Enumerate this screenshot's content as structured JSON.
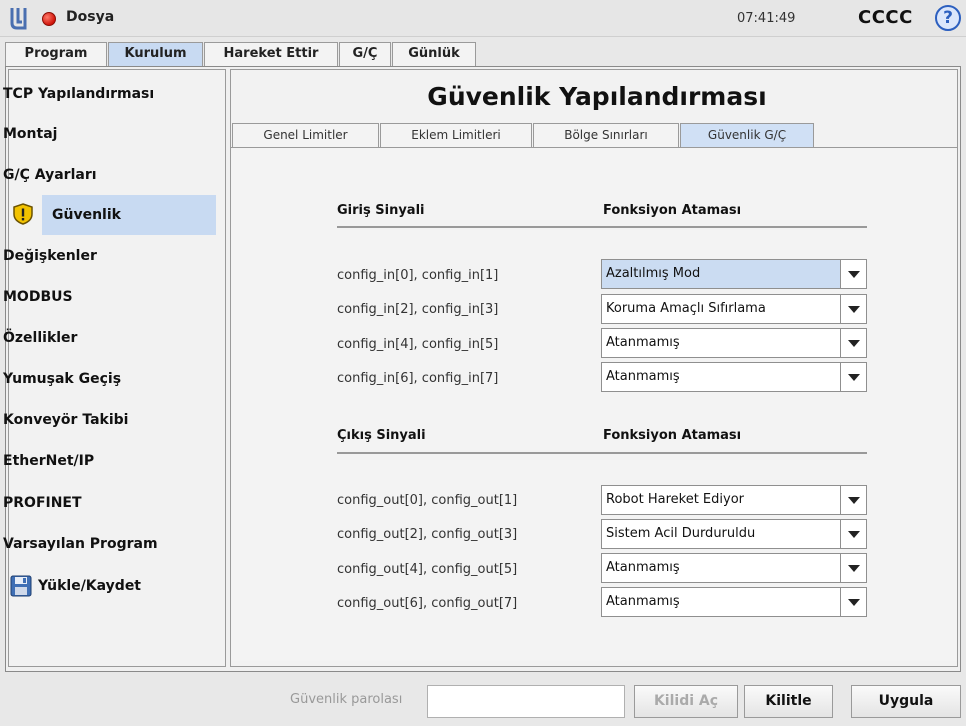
{
  "titlebar": {
    "app_name": "Dosya",
    "time": "07:41:49",
    "robot_name": "CCCC",
    "help": "?"
  },
  "top_tabs": [
    "Program",
    "Kurulum",
    "Hareket Ettir",
    "G/Ç",
    "Günlük"
  ],
  "active_top_tab": "Kurulum",
  "sidebar": {
    "items": [
      "TCP Yapılandırması",
      "Montaj",
      "G/Ç Ayarları",
      "Güvenlik",
      "Değişkenler",
      "MODBUS",
      "Özellikler",
      "Yumuşak Geçiş",
      "Konveyör Takibi",
      "EtherNet/IP",
      "PROFINET",
      "Varsayılan Program",
      "Yükle/Kaydet"
    ],
    "active": "Güvenlik"
  },
  "page": {
    "title": "Güvenlik Yapılandırması",
    "sub_tabs": [
      "Genel Limitler",
      "Eklem Limitleri",
      "Bölge Sınırları",
      "Güvenlik G/Ç"
    ],
    "active_sub_tab": "Güvenlik G/Ç"
  },
  "input_section": {
    "signal_header": "Giriş Sinyali",
    "function_header": "Fonksiyon Ataması",
    "rows": [
      {
        "signal": "config_in[0], config_in[1]",
        "function": "Azaltılmış Mod"
      },
      {
        "signal": "config_in[2], config_in[3]",
        "function": "Koruma Amaçlı Sıfırlama"
      },
      {
        "signal": "config_in[4], config_in[5]",
        "function": "Atanmamış"
      },
      {
        "signal": "config_in[6], config_in[7]",
        "function": "Atanmamış"
      }
    ]
  },
  "output_section": {
    "signal_header": "Çıkış Sinyali",
    "function_header": "Fonksiyon Ataması",
    "rows": [
      {
        "signal": "config_out[0], config_out[1]",
        "function": "Robot Hareket Ediyor"
      },
      {
        "signal": "config_out[2], config_out[3]",
        "function": "Sistem Acil Durduruldu"
      },
      {
        "signal": "config_out[4], config_out[5]",
        "function": "Atanmamış"
      },
      {
        "signal": "config_out[6], config_out[7]",
        "function": "Atanmamış"
      }
    ]
  },
  "bottom": {
    "password_label": "Güvenlik parolası",
    "password_value": "",
    "unlock_label": "Kilidi Aç",
    "lock_label": "Kilitle",
    "apply_label": "Uygula"
  },
  "colors": {
    "selection": "#c8daf2",
    "status_dot": "#d0140a",
    "help_icon": "#2c5fbf",
    "warning_icon": "#f2c200"
  }
}
